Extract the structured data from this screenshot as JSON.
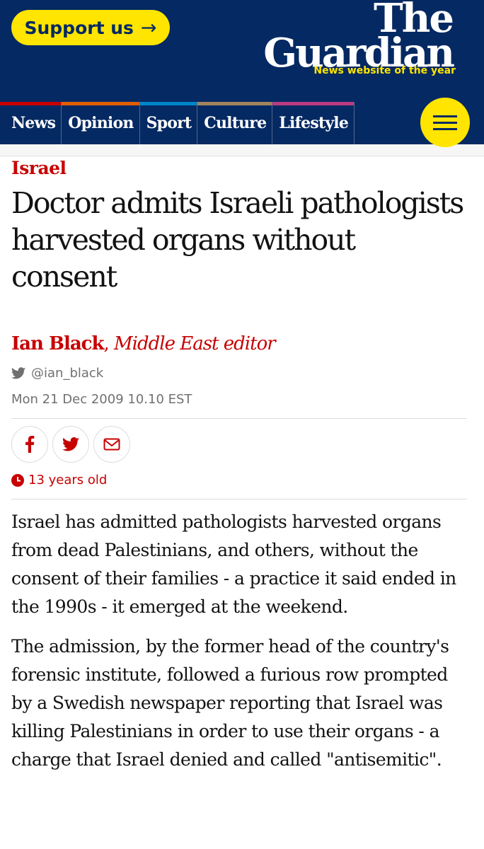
{
  "header": {
    "support_label": "Support us",
    "support_arrow": "→",
    "logo_line1": "The",
    "logo_line2": "Guardian",
    "tagline": "News website of the year"
  },
  "nav": {
    "items": [
      {
        "label": "News",
        "accent": "#c70000"
      },
      {
        "label": "Opinion",
        "accent": "#e05e00"
      },
      {
        "label": "Sport",
        "accent": "#0084c6"
      },
      {
        "label": "Culture",
        "accent": "#a1845c"
      },
      {
        "label": "Lifestyle",
        "accent": "#bb3b80"
      }
    ],
    "menu_icon": "hamburger-icon"
  },
  "article": {
    "section": "Israel",
    "headline": "Doctor admits Israeli pathologists harvested organs without consent",
    "author": "Ian Black",
    "role": "Middle East editor",
    "twitter_handle": "@ian_black",
    "date": "Mon 21 Dec 2009 10.10 EST",
    "age": "13 years old",
    "paragraphs": [
      "Israel has admitted pathologists harvested organs from dead Palestinians, and others, without the consent of their families - a practice it said ended in the 1990s - it emerged at the weekend.",
      "The admission, by the former head of the country's forensic institute, followed a furious row prompted by a Swedish newspaper reporting that Israel was killing Palestinians in order to use their organs - a charge that Israel denied and called \"antisemitic\"."
    ]
  },
  "colors": {
    "brand_blue": "#052962",
    "support_yellow": "#ffe500",
    "news_red": "#c70000"
  }
}
